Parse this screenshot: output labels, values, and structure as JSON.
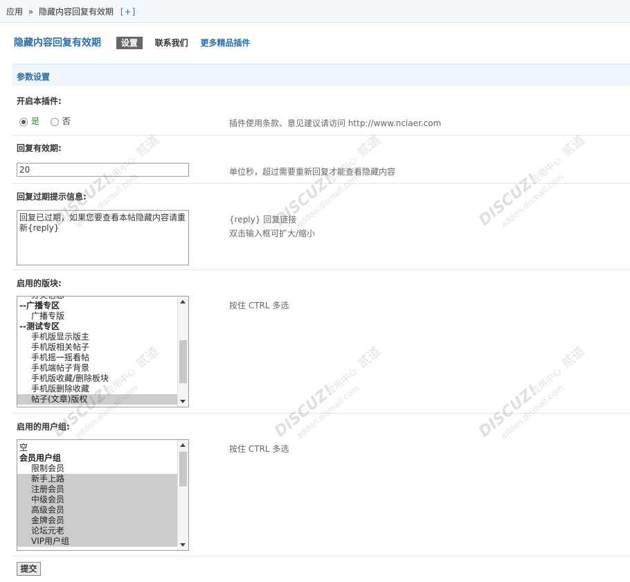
{
  "breadcrumb": {
    "root": "应用",
    "separator": "»",
    "current": "隐藏内容回复有效期",
    "add": "[+]"
  },
  "plugin_nav": {
    "title": "隐藏内容回复有效期",
    "tabs": [
      {
        "label": "设置"
      },
      {
        "label": "联系我们"
      },
      {
        "label": "更多精品插件"
      }
    ]
  },
  "section": {
    "title": "参数设置"
  },
  "fields": {
    "enable": {
      "label": "开启本插件:",
      "yes_label": "是",
      "no_label": "否",
      "value": "是",
      "tip": "插件使用条款、意见建议请访问 http://www.nciaer.com"
    },
    "duration": {
      "label": "回复有效期:",
      "value": "20",
      "tip": "单位秒，超过需要重新回复才能查看隐藏内容"
    },
    "expired_msg": {
      "label": "回复过期提示信息:",
      "value": "回复已过期，如果您要查看本帖隐藏内容请重新{reply}",
      "tip_line1": "{reply} 回复链接",
      "tip_line2": "双击输入框可扩大/缩小"
    },
    "forums": {
      "label": "启用的版块:",
      "tip": "按住 CTRL 多选",
      "options": [
        {
          "text": "分类信息",
          "type": "child",
          "selected": false
        },
        {
          "text": "--广播专区",
          "type": "group",
          "selected": false
        },
        {
          "text": "广播专版",
          "type": "child",
          "selected": false
        },
        {
          "text": "--测试专区",
          "type": "group",
          "selected": false
        },
        {
          "text": "手机版显示版主",
          "type": "child",
          "selected": false
        },
        {
          "text": "手机版相关帖子",
          "type": "child",
          "selected": false
        },
        {
          "text": "手机摇一摇看帖",
          "type": "child",
          "selected": false
        },
        {
          "text": "手机端帖子背景",
          "type": "child",
          "selected": false
        },
        {
          "text": "手机版收藏/删除板块",
          "type": "child",
          "selected": false
        },
        {
          "text": "手机版删除收藏",
          "type": "child",
          "selected": false
        },
        {
          "text": "帖子(文章)版权",
          "type": "child",
          "selected": true
        }
      ]
    },
    "usergroups": {
      "label": "启用的用户组:",
      "tip": "按住 CTRL 多选",
      "options": [
        {
          "text": "空",
          "type": "plain",
          "selected": false
        },
        {
          "text": "会员用户组",
          "type": "group",
          "selected": false
        },
        {
          "text": "限制会员",
          "type": "child",
          "selected": false
        },
        {
          "text": "新手上路",
          "type": "child",
          "selected": true
        },
        {
          "text": "注册会员",
          "type": "child",
          "selected": true
        },
        {
          "text": "中级会员",
          "type": "child",
          "selected": true
        },
        {
          "text": "高级会员",
          "type": "child",
          "selected": true
        },
        {
          "text": "金牌会员",
          "type": "child",
          "selected": true
        },
        {
          "text": "论坛元老",
          "type": "child",
          "selected": true
        },
        {
          "text": "VIP用户组",
          "type": "child",
          "selected": true
        }
      ]
    }
  },
  "submit": {
    "label": "提交"
  },
  "watermark": {
    "brand": "DISCUZ!",
    "cn": "应用中心",
    "url": "addon.dismall.com",
    "mark": "贰道"
  },
  "colors": {
    "link": "#2b6ea8",
    "yes_green": "#2a8a2a",
    "selected_bg": "#cccccc",
    "header_bg": "#eef5fb"
  }
}
